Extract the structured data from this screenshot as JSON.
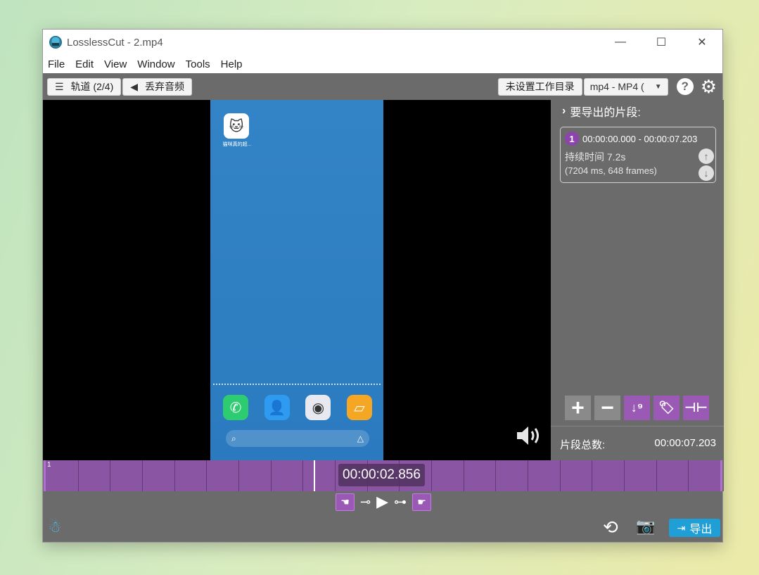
{
  "window": {
    "title": "LosslessCut - 2.mp4",
    "controls": {
      "minimize": "—",
      "maximize": "☐",
      "close": "✕"
    }
  },
  "menu": {
    "items": [
      "File",
      "Edit",
      "View",
      "Window",
      "Tools",
      "Help"
    ]
  },
  "toolbar": {
    "tracks_label": "轨道 (2/4)",
    "discard_audio_label": "丢弃音频",
    "workdir_label": "未设置工作目录",
    "format_value": "mp4 - MP4 (",
    "help_label": "?"
  },
  "preview": {
    "app_icon_label": "猫咪真的超...",
    "dock_icons": [
      "phone-icon",
      "contacts-icon",
      "camera-icon",
      "notes-icon"
    ],
    "dock_colors": [
      "#2ecc71",
      "#2e9bf0",
      "#e8e8f0",
      "#f5a623"
    ]
  },
  "segments_panel": {
    "header": "要导出的片段:",
    "segments": [
      {
        "number": "1",
        "time_range": "00:00:00.000 - 00:00:07.203",
        "duration": "持续时间 7.2s",
        "frames": "(7204 ms, 648 frames)"
      }
    ],
    "tools": [
      "add-segment",
      "remove-segment",
      "sort-segments",
      "label-segment",
      "split-segment"
    ],
    "total_label": "片段总数:",
    "total_value": "00:00:07.203"
  },
  "timeline": {
    "segment_label": "1",
    "current_time": "00:00:02.856",
    "playhead_fraction": 0.397
  },
  "bottom": {
    "export_label": "导出"
  },
  "colors": {
    "segment": "#8a55a3",
    "accent_purple": "#9b59b6",
    "export_blue": "#1f9fd6",
    "panel_gray": "#6b6b6b"
  }
}
